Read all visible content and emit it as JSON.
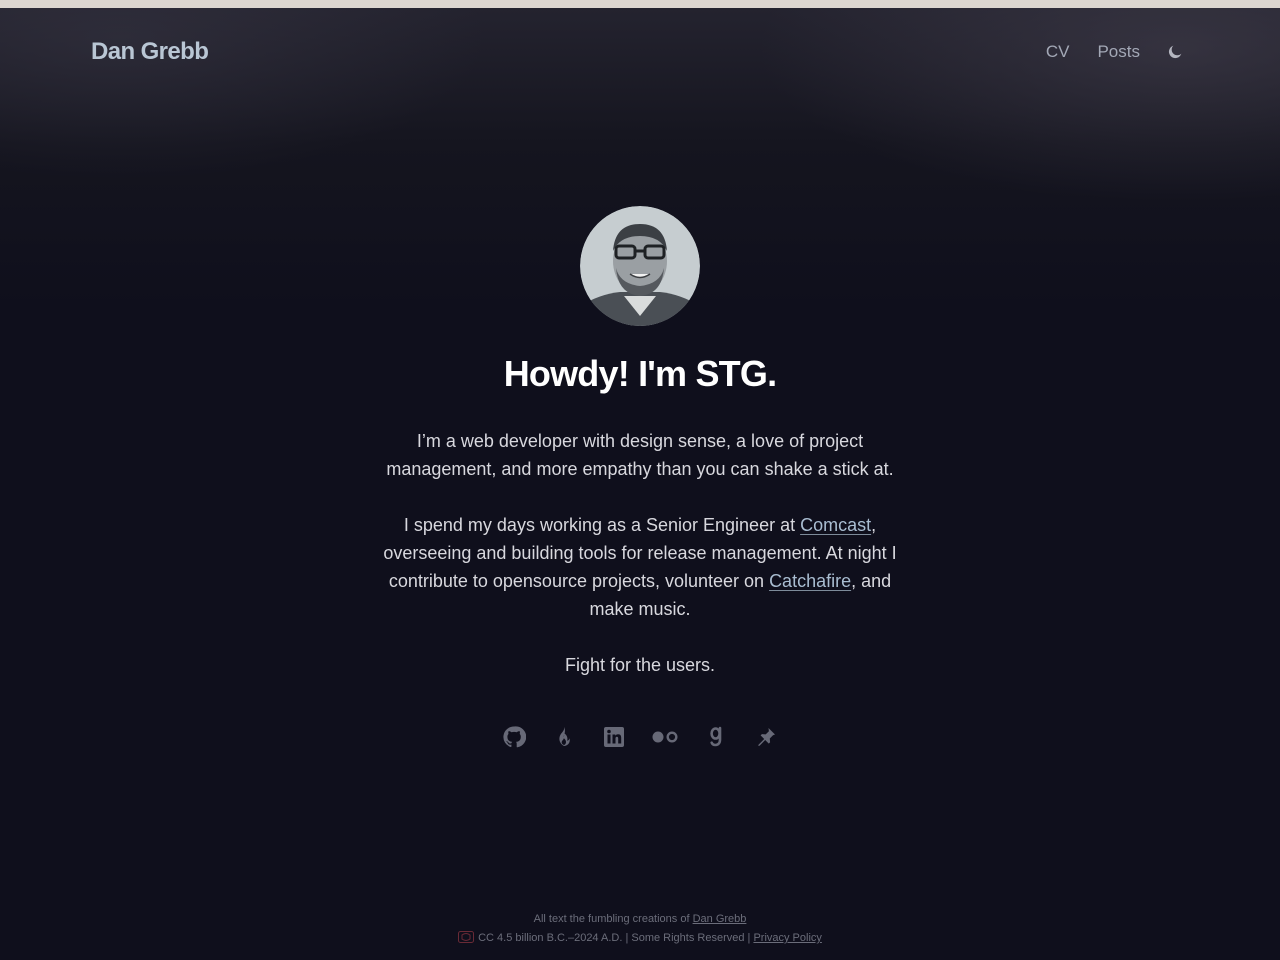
{
  "header": {
    "site_title": "Dan Grebb",
    "nav": [
      {
        "label": "CV"
      },
      {
        "label": "Posts"
      }
    ],
    "theme_toggle_icon": "moon-icon"
  },
  "hero": {
    "avatar_icon": "avatar-photo",
    "heading": "Howdy! I'm STG.",
    "intro_1": "I’m a web developer with design sense, a love of project management, and more empathy than you can shake a stick at.",
    "intro_2_a": "I spend my days working as a Senior Engineer at ",
    "intro_2_link1": "Comcast",
    "intro_2_b": ", overseeing and building tools for release management. At night I contribute to opensource projects, volunteer on ",
    "intro_2_link2": "Catchafire",
    "intro_2_c": ", and make music.",
    "intro_3": "Fight for the users."
  },
  "socials": [
    {
      "icon": "github-icon"
    },
    {
      "icon": "flame-icon"
    },
    {
      "icon": "linkedin-icon"
    },
    {
      "icon": "flickr-icon"
    },
    {
      "icon": "goodreads-icon"
    },
    {
      "icon": "pin-icon"
    }
  ],
  "footer": {
    "line1_text": "All text the fumbling creations of ",
    "line1_link": "Dan Grebb",
    "line2_text": "CC 4.5 billion B.C.–2024 A.D. | Some Rights Reserved | ",
    "line2_link": "Privacy Policy"
  },
  "colors": {
    "background": "#0f0f1c",
    "topbar": "#dcd6d0",
    "title": "#b9c6d4",
    "link": "#a9bdd1",
    "heading": "#ffffff"
  }
}
